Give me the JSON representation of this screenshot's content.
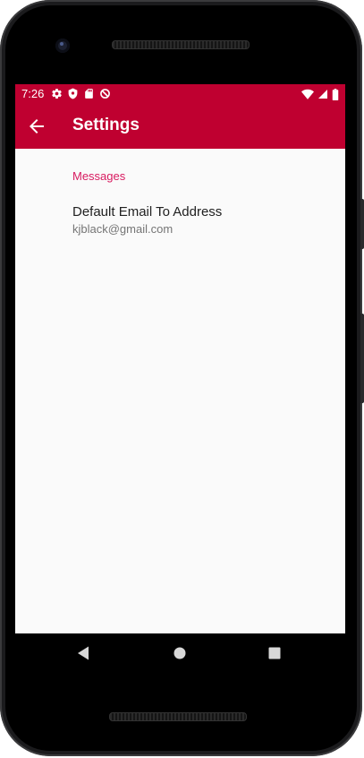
{
  "status_bar": {
    "time": "7:26",
    "left_icons": [
      "settings-icon",
      "shield-icon",
      "sd-card-icon",
      "data-saver-icon"
    ],
    "right_icons": [
      "wifi-icon",
      "signal-icon",
      "battery-icon"
    ]
  },
  "app_bar": {
    "title": "Settings",
    "back_icon": "arrow-back-icon"
  },
  "preferences": {
    "section_header": "Messages",
    "items": [
      {
        "title": "Default Email To Address",
        "summary": "kjblack@gmail.com"
      }
    ]
  },
  "navigation_bar": {
    "buttons": [
      "back-triangle-icon",
      "home-circle-icon",
      "recents-square-icon"
    ]
  },
  "colors": {
    "primary": "#bf0030",
    "accent": "#d81b60",
    "background": "#fafafa",
    "title_text": "#212121",
    "summary_text": "#757575"
  }
}
